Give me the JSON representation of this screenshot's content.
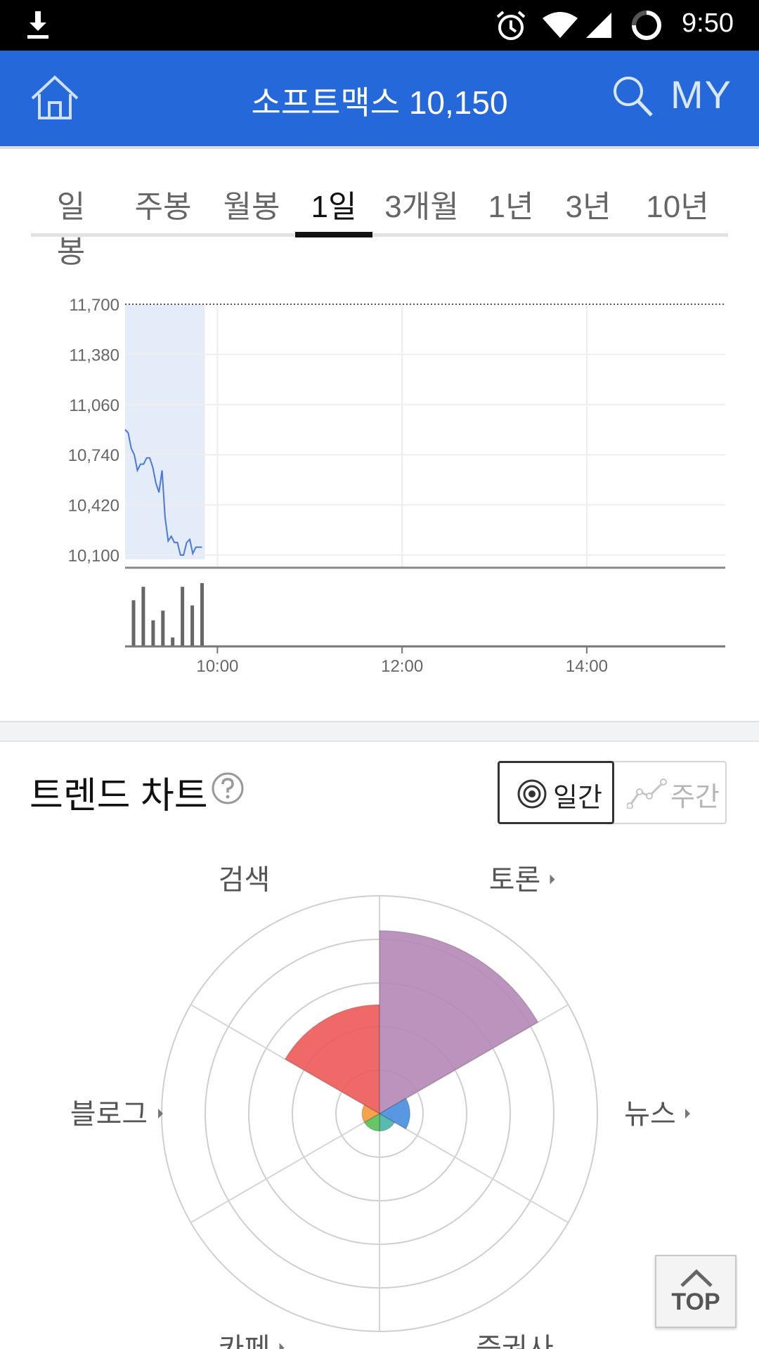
{
  "status_bar": {
    "time": "9:50",
    "icons": [
      "download-icon",
      "alarm-icon",
      "wifi-icon",
      "signal-icon",
      "battery-icon"
    ]
  },
  "header": {
    "title": "소프트맥스 10,150",
    "my_label": "MY",
    "accent_color": "#2468d9",
    "icons": [
      "home-icon",
      "search-icon"
    ]
  },
  "tabs": {
    "items": [
      "일봉",
      "주봉",
      "월봉",
      "1일",
      "3개월",
      "1년",
      "3년",
      "10년"
    ],
    "active": "1일"
  },
  "chart_data": {
    "type": "line",
    "y_ticks": [
      "11,700",
      "11,380",
      "11,060",
      "10,740",
      "10,420",
      "10,100"
    ],
    "x_ticks": [
      "10:00",
      "12:00",
      "14:00"
    ],
    "ylim": [
      10100,
      11700
    ],
    "series": [
      {
        "times": [
          "09:00",
          "09:02",
          "09:04",
          "09:06",
          "09:08",
          "09:10",
          "09:12",
          "09:14",
          "09:16",
          "09:18",
          "09:20",
          "09:22",
          "09:24",
          "09:26",
          "09:28",
          "09:30",
          "09:32",
          "09:34",
          "09:36",
          "09:38",
          "09:40",
          "09:42",
          "09:44",
          "09:46",
          "09:48",
          "09:50"
        ],
        "values": [
          10900,
          10880,
          10780,
          10740,
          10640,
          10680,
          10680,
          10720,
          10720,
          10660,
          10560,
          10500,
          10640,
          10340,
          10190,
          10220,
          10180,
          10180,
          10100,
          10100,
          10180,
          10200,
          10110,
          10150,
          10150,
          10150
        ],
        "color": "#4a78e0"
      }
    ],
    "volume": {
      "values": [
        62,
        80,
        35,
        48,
        12,
        80,
        55,
        85
      ],
      "color": "#666666"
    },
    "highlight_color": "#e4ecfa",
    "grid": true
  },
  "trend": {
    "title": "트렌드 차트",
    "toggle": {
      "daily": "일간",
      "weekly": "주간",
      "active": "daily"
    },
    "radar": {
      "categories": [
        "검색",
        "토론",
        "뉴스",
        "증권사",
        "카페",
        "블로그"
      ],
      "category_arrows": [
        false,
        true,
        true,
        false,
        true,
        true
      ],
      "values": [
        2.5,
        4.2,
        0.7,
        0.4,
        0.4,
        0.4
      ],
      "colors": [
        "#ee5c5c",
        "#b487b5",
        "#4a8fe0",
        "#49b6a6",
        "#5ac05a",
        "#f39a3e"
      ],
      "max": 5
    }
  },
  "top_button": {
    "label": "TOP"
  }
}
